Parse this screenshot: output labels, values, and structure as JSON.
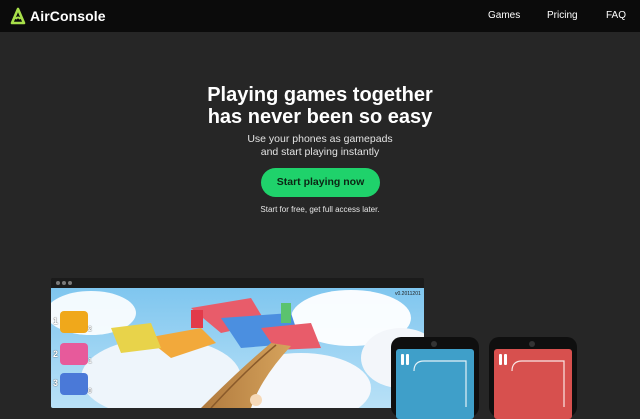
{
  "header": {
    "brand": "AirConsole",
    "nav": [
      "Games",
      "Pricing",
      "FAQ"
    ]
  },
  "hero": {
    "title_line1": "Playing games together",
    "title_line2": "has never been so easy",
    "sub_line1": "Use your phones as gamepads",
    "sub_line2": "and start playing instantly",
    "cta": "Start playing now",
    "note": "Start for free, get full access later."
  },
  "game": {
    "version": "v0.2011201",
    "players": [
      {
        "rank": "1",
        "score": "2",
        "color": "#f0a81b"
      },
      {
        "rank": "2",
        "score": "1",
        "color": "#e75a9b"
      },
      {
        "rank": "3",
        "score": "0",
        "color": "#4a79d8"
      }
    ]
  },
  "colors": {
    "accent": "#1fd26b",
    "background": "#262626",
    "topbar": "#0b0b0b",
    "phone_blue": "#3f9fc9",
    "phone_red": "#d7504e"
  },
  "icons": [
    "airconsole-logo-icon",
    "pause-icon"
  ]
}
